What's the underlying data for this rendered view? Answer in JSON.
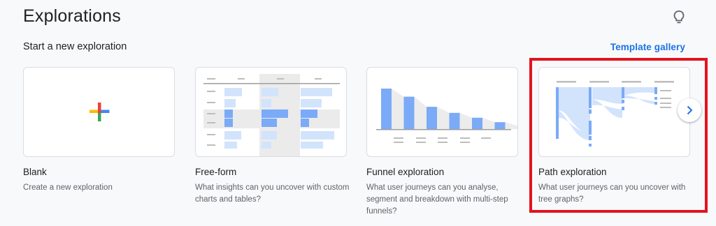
{
  "header": {
    "title": "Explorations",
    "help_icon": "lightbulb-icon"
  },
  "section": {
    "title": "Start a new exploration",
    "gallery_link": "Template gallery"
  },
  "cards": [
    {
      "title": "Blank",
      "description": "Create a new exploration",
      "icon": "plus-icon"
    },
    {
      "title": "Free-form",
      "description": "What insights can you uncover with custom charts and tables?"
    },
    {
      "title": "Funnel exploration",
      "description": "What user journeys can you analyse, segment and breakdown with multi-step funnels?",
      "funnel_bars": [
        1.0,
        0.8,
        0.55,
        0.4,
        0.28,
        0.17,
        0.08
      ]
    },
    {
      "title": "Path exploration",
      "description": "What user journeys can you uncover with tree graphs?"
    }
  ],
  "navigation": {
    "next_icon": "chevron-right-icon"
  },
  "colors": {
    "accent": "#1a73e8",
    "highlight": "#e3131e",
    "thumb_blue": "#7baaf7",
    "thumb_light_blue": "#d2e3fc"
  }
}
